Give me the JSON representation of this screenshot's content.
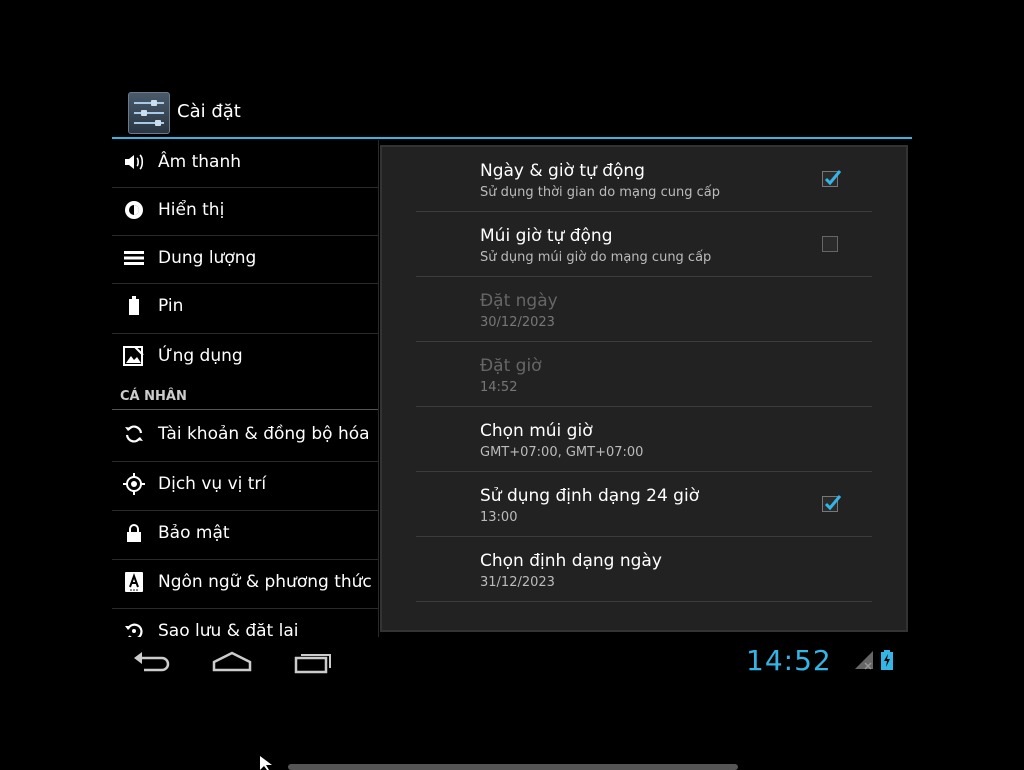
{
  "app": {
    "title": "Cài đặt",
    "icon": "settings-sliders-icon",
    "accent_color": "#33b5e5"
  },
  "left_menu": {
    "items": [
      {
        "label": "Âm thanh",
        "icon": "sound-icon"
      },
      {
        "label": "Hiển thị",
        "icon": "display-icon"
      },
      {
        "label": "Dung lượng",
        "icon": "storage-icon"
      },
      {
        "label": "Pin",
        "icon": "battery-icon"
      },
      {
        "label": "Ứng dụng",
        "icon": "apps-icon"
      }
    ],
    "section_header": "CÁ NHÂN",
    "personal_items": [
      {
        "label": "Tài khoản & đồng bộ hóa",
        "icon": "sync-icon"
      },
      {
        "label": "Dịch vụ vị trí",
        "icon": "location-icon"
      },
      {
        "label": "Bảo mật",
        "icon": "lock-icon"
      },
      {
        "label": "Ngôn ngữ & phương thức",
        "icon": "language-icon"
      },
      {
        "label": "Sao lưu & đặt lại",
        "icon": "backup-icon"
      }
    ]
  },
  "date_time": {
    "prefs": [
      {
        "title": "Ngày & giờ tự động",
        "summary": "Sử dụng thời gian do mạng cung cấp",
        "checkbox": true,
        "checked": true,
        "enabled": true
      },
      {
        "title": "Múi giờ tự động",
        "summary": "Sử dụng múi giờ do mạng cung cấp",
        "checkbox": true,
        "checked": false,
        "enabled": true
      },
      {
        "title": "Đặt ngày",
        "summary": "30/12/2023",
        "checkbox": false,
        "enabled": false
      },
      {
        "title": "Đặt giờ",
        "summary": "14:52",
        "checkbox": false,
        "enabled": false
      },
      {
        "title": "Chọn múi giờ",
        "summary": "GMT+07:00, GMT+07:00",
        "checkbox": false,
        "enabled": true
      },
      {
        "title": "Sử dụng định dạng 24 giờ",
        "summary": "13:00",
        "checkbox": true,
        "checked": true,
        "enabled": true
      },
      {
        "title": "Chọn định dạng ngày",
        "summary": "31/12/2023",
        "checkbox": false,
        "enabled": true
      }
    ]
  },
  "status_bar": {
    "clock": "14:52",
    "icons": [
      "back-icon",
      "home-icon",
      "recent-apps-icon",
      "signal-icon",
      "battery-charging-icon"
    ]
  }
}
